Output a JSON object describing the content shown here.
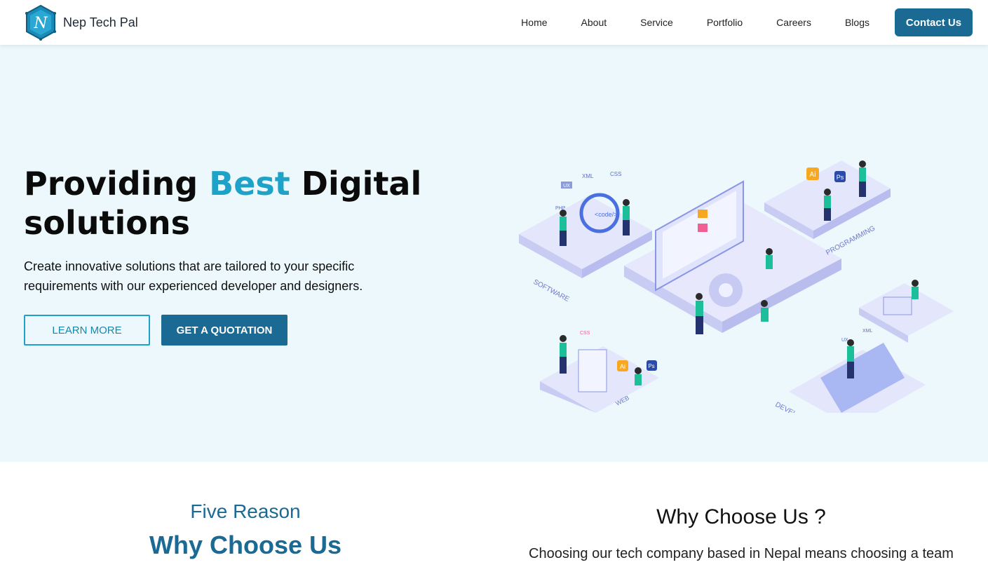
{
  "header": {
    "brand_name": "Nep Tech Pal",
    "logo_letter": "N",
    "nav": [
      "Home",
      "About",
      "Service",
      "Portfolio",
      "Careers",
      "Blogs"
    ],
    "contact_label": "Contact Us"
  },
  "hero": {
    "title_part1": "Providing ",
    "title_accent": "Best",
    "title_part2": " Digital solutions",
    "description": "Create innovative solutions that are tailored to your specific requirements with our experienced developer and designers.",
    "learn_more": "LEARN MORE",
    "quotation": "GET A QUOTATION"
  },
  "illustration": {
    "labels": {
      "software": "SOFTWARE",
      "programming": "PROGRAMMING",
      "web": "WEB",
      "development": "DEVELOPMENT",
      "code": "<code/>",
      "ux": "UX",
      "xml": "XML",
      "css": "CSS",
      "ai": "Ai",
      "ps": "Ps",
      "php": "PHP"
    }
  },
  "reasons": {
    "five_reason": "Five Reason",
    "why_choose": "Why Choose Us",
    "why_choose_q": "Why Choose Us ?",
    "description": "Choosing our tech company based in Nepal means choosing a team"
  },
  "colors": {
    "primary": "#1a6a93",
    "accent": "#1fa2c8",
    "hero_bg": "#ecf8fb"
  }
}
